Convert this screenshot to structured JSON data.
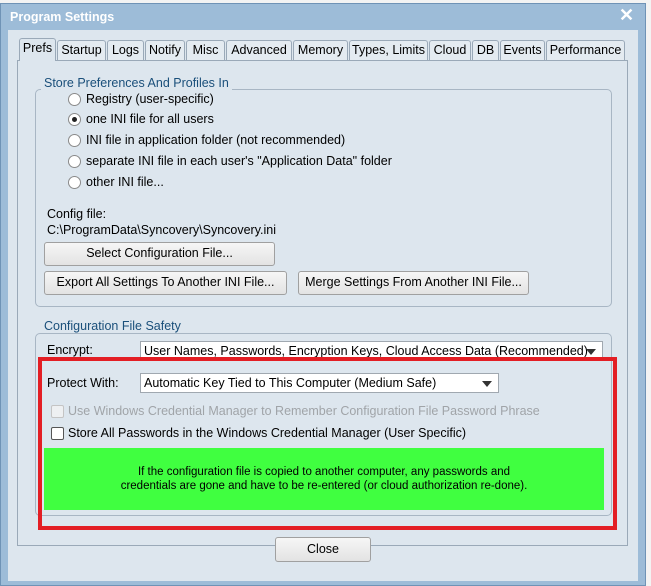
{
  "window": {
    "title": "Program Settings",
    "close_icon": "close-x-icon"
  },
  "tabs": [
    {
      "label": "Prefs",
      "active": true
    },
    {
      "label": "Startup"
    },
    {
      "label": "Logs"
    },
    {
      "label": "Notify"
    },
    {
      "label": "Misc"
    },
    {
      "label": "Advanced"
    },
    {
      "label": "Memory"
    },
    {
      "label": "Types, Limits"
    },
    {
      "label": "Cloud"
    },
    {
      "label": "DB"
    },
    {
      "label": "Events"
    },
    {
      "label": "Performance"
    }
  ],
  "store": {
    "title": "Store Preferences And Profiles In",
    "options": [
      {
        "label": "Registry (user-specific)",
        "selected": false
      },
      {
        "label": "one INI file for all users",
        "selected": true
      },
      {
        "label": "INI file in application folder (not recommended)",
        "selected": false
      },
      {
        "label": "separate INI file in each user's \"Application Data\" folder",
        "selected": false
      },
      {
        "label": "other INI file...",
        "selected": false
      }
    ],
    "config_label": "Config file:",
    "config_path": "C:\\ProgramData\\Syncovery\\Syncovery.ini",
    "select_button": "Select Configuration File...",
    "export_button": "Export All Settings To Another INI File...",
    "merge_button": "Merge Settings From Another INI File..."
  },
  "safety": {
    "title": "Configuration File Safety",
    "encrypt_label": "Encrypt:",
    "encrypt_value": "User Names, Passwords, Encryption Keys, Cloud Access Data (Recommended)",
    "protect_label": "Protect With:",
    "protect_value": "Automatic Key Tied to This Computer (Medium Safe)",
    "cred_phrase": {
      "label": "Use Windows Credential Manager to Remember Configuration File Password Phrase",
      "checked": false,
      "disabled": true
    },
    "cred_all": {
      "label": "Store All Passwords in the Windows Credential Manager (User Specific)",
      "checked": false
    },
    "info_line1": "If the configuration file is copied to another computer, any passwords and",
    "info_line2": "credentials are gone and have to be re-entered (or cloud authorization re-done).",
    "info_color": "#40ff40",
    "highlight_color": "#e31e24"
  },
  "footer": {
    "close_button": "Close"
  }
}
